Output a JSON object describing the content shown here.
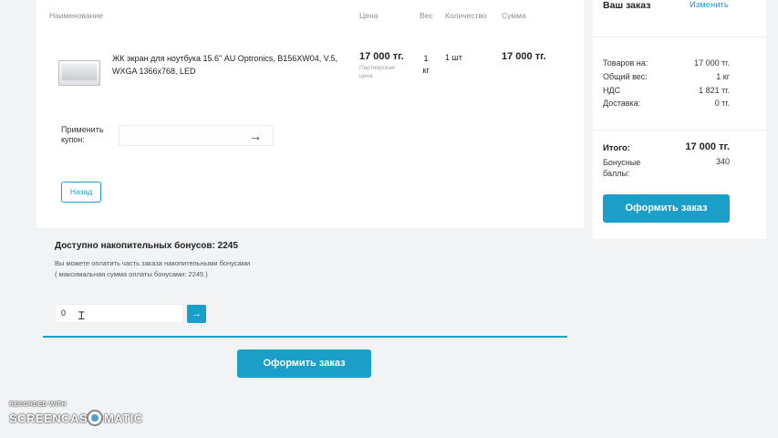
{
  "table": {
    "columns": {
      "name": "Наименование",
      "price": "Цена",
      "weight": "Вес",
      "qty": "Количество",
      "sum": "Сумма"
    }
  },
  "product": {
    "name": "ЖК экран для ноутбука 15.6\" AU Optronics, B156XW04, V.5, WXGA 1366x768, LED",
    "price": "17 000 тг.",
    "price_note": "Партнерская цена",
    "weight": "1 кг",
    "qty": "1 шт",
    "sum": "17 000 тг."
  },
  "coupon": {
    "label": "Применить купон:",
    "value": "",
    "arrow": "→"
  },
  "back_button": "Назад",
  "bonus": {
    "title": "Доступно накопительных бонусов: 2245",
    "line1": "Вы можете оплатить часть заказа накопительными бонусами",
    "line2": "( максимальная сумма оплаты бонусами: 2245 )",
    "input_value": "0",
    "go": "→"
  },
  "main_order_button": "Оформить заказ",
  "sidebar": {
    "title": "Ваш заказ",
    "edit": "Изменить",
    "rows": [
      {
        "label": "Товаров на:",
        "value": "17 000 тг."
      },
      {
        "label": "Общий вес:",
        "value": "1 кг"
      },
      {
        "label": "НДС",
        "value": "1 821 тг."
      },
      {
        "label": "Доставка:",
        "value": "0 тг."
      }
    ],
    "total_label": "Итого:",
    "total_value": "17 000 тг.",
    "bonus_label": "Бонусные баллы:",
    "bonus_value": "340",
    "order_button": "Оформить заказ"
  },
  "watermark": {
    "top": "RECORDED WITH",
    "left": "SCREENCAST",
    "right": "MATIC"
  },
  "colors": {
    "accent": "#1a9fc9",
    "background": "#f2f3f4"
  }
}
